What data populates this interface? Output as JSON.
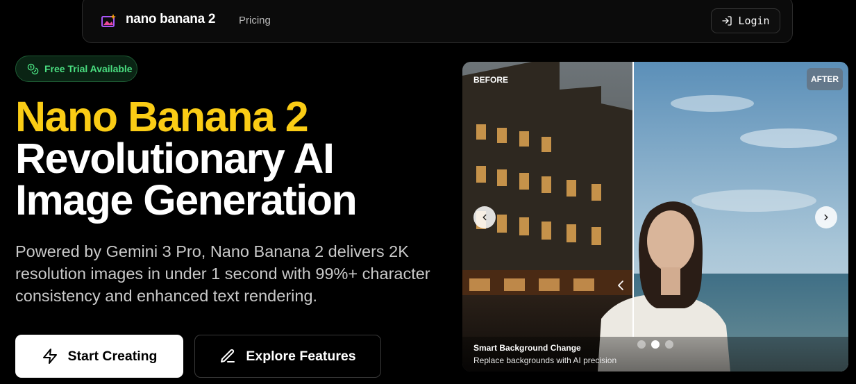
{
  "nav": {
    "brand": "nano banana 2",
    "links": [
      "Pricing"
    ],
    "login_label": "Login"
  },
  "hero": {
    "badge": "Free Trial Available",
    "title_line1": "Nano Banana 2",
    "title_line2": "Revolutionary AI",
    "title_line3": "Image Generation",
    "description": "Powered by Gemini 3 Pro, Nano Banana 2 delivers 2K resolution images in under 1 second with 99%+ character consistency and enhanced text rendering.",
    "primary_cta": "Start Creating",
    "secondary_cta": "Explore Features"
  },
  "comparison": {
    "before_label": "BEFORE",
    "after_label": "AFTER",
    "caption_title": "Smart Background Change",
    "caption_subtitle": "Replace backgrounds with AI precision",
    "slides": 3,
    "active_slide": 2
  },
  "colors": {
    "accent_yellow": "#facc15",
    "badge_green": "#4ade80",
    "background": "#000000"
  },
  "icons": {
    "logo": "image-sparkle-icon",
    "login": "login-icon",
    "badge": "coins-icon",
    "primary_cta": "lightning-icon",
    "secondary_cta": "pen-icon",
    "prev": "chevron-left-icon",
    "next": "chevron-right-icon"
  }
}
